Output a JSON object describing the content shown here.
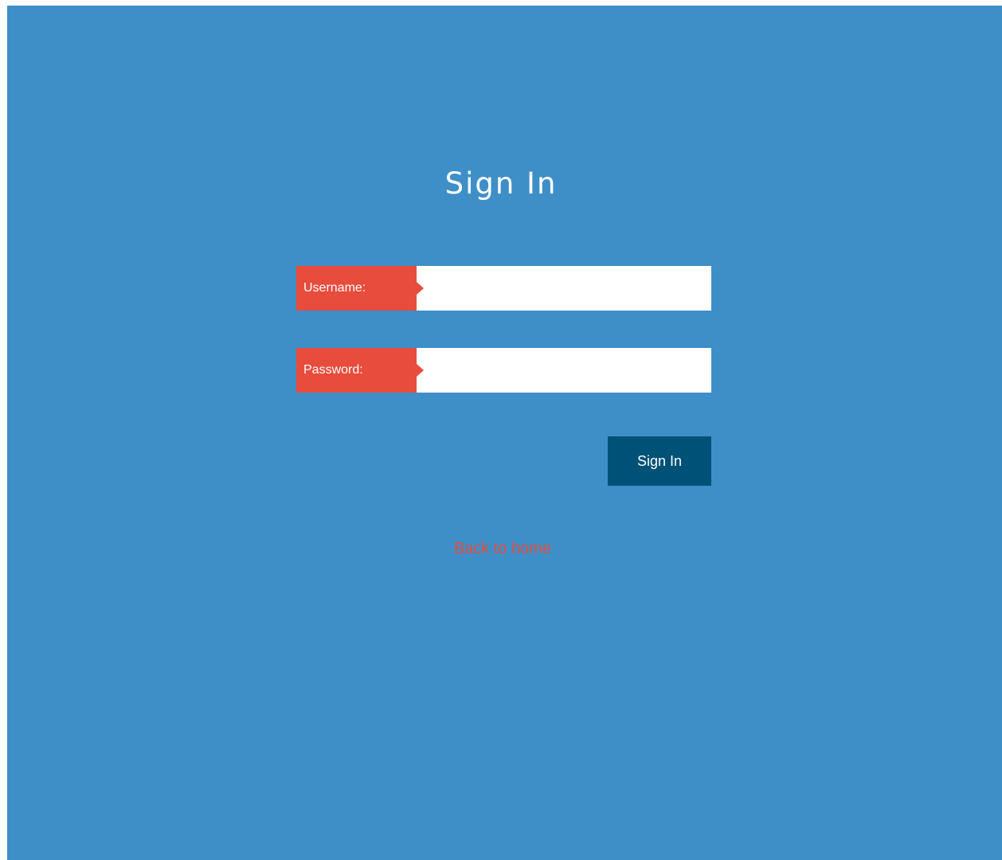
{
  "page": {
    "title": "Sign In"
  },
  "form": {
    "username": {
      "label": "Username:",
      "value": "",
      "placeholder": ""
    },
    "password": {
      "label": "Password:",
      "value": "",
      "placeholder": ""
    },
    "submit_label": "Sign In"
  },
  "links": {
    "back_to_home": "Back to home"
  },
  "colors": {
    "background": "#3e8fc7",
    "accent": "#e74c3c",
    "button": "#005177",
    "text": "#ffffff"
  }
}
